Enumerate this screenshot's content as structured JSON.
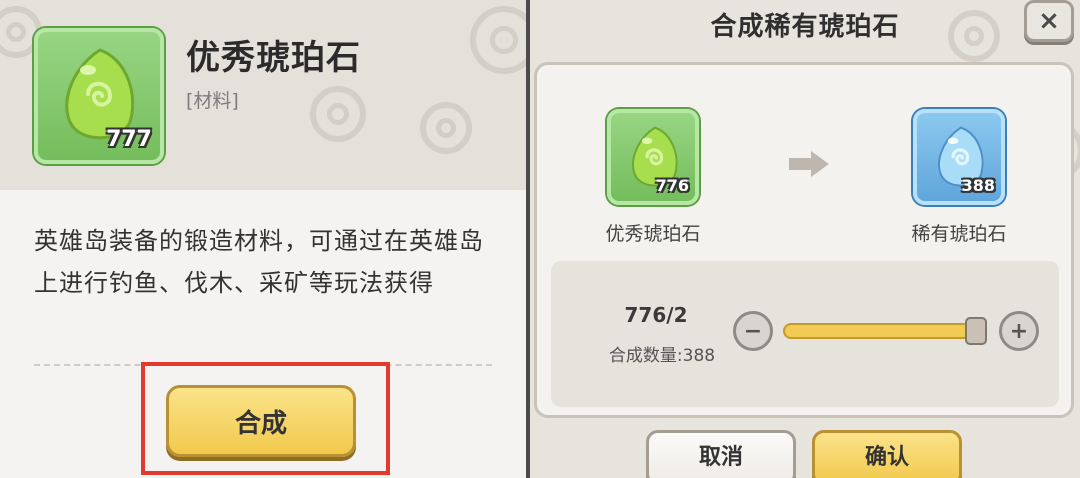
{
  "left_panel": {
    "item": {
      "name": "优秀琥珀石",
      "type": "[材料]",
      "count": "777",
      "icon": "green-amber-gem-icon"
    },
    "description": "英雄岛装备的锻造材料，可通过在英雄岛上进行钓鱼、伐木、采矿等玩法获得",
    "craft_button": "合成",
    "highlight_color": "#e23b2e"
  },
  "dialog": {
    "title": "合成稀有琥珀石",
    "close_icon": "×",
    "source_item": {
      "name": "优秀琥珀石",
      "count": "776",
      "icon": "green-amber-gem-icon"
    },
    "target_item": {
      "name": "稀有琥珀石",
      "count": "388",
      "icon": "blue-amber-gem-icon"
    },
    "quantity_ratio": "776/2",
    "craft_quantity": "合成数量:388",
    "slider_level": 1.0,
    "minus_label": "−",
    "plus_label": "+",
    "cancel_button": "取消",
    "confirm_button": "确认"
  },
  "colors": {
    "accent_yellow": "#f1c94c",
    "green_card": "#74bd5c",
    "blue_card": "#5fa6dc"
  }
}
